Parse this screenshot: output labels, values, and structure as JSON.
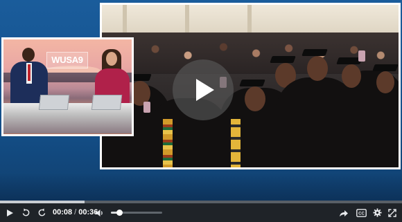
{
  "player": {
    "current_time": "00:08",
    "separator": "/",
    "duration": "00:36",
    "progress_fraction": 0.21,
    "volume_fraction": 0.16
  },
  "pip": {
    "logo_text": "WUSA9"
  },
  "icons": {
    "play": "play-icon",
    "replay": "replay-icon",
    "forward": "forward-icon",
    "volume": "volume-icon",
    "share": "share-icon",
    "captions": "closed-captions-icon",
    "settings": "gear-icon",
    "fullscreen": "fullscreen-icon",
    "big_play": "play-icon"
  },
  "colors": {
    "background": "#15548f",
    "control_bar": "#1f2328",
    "accent": "#ffffff"
  }
}
